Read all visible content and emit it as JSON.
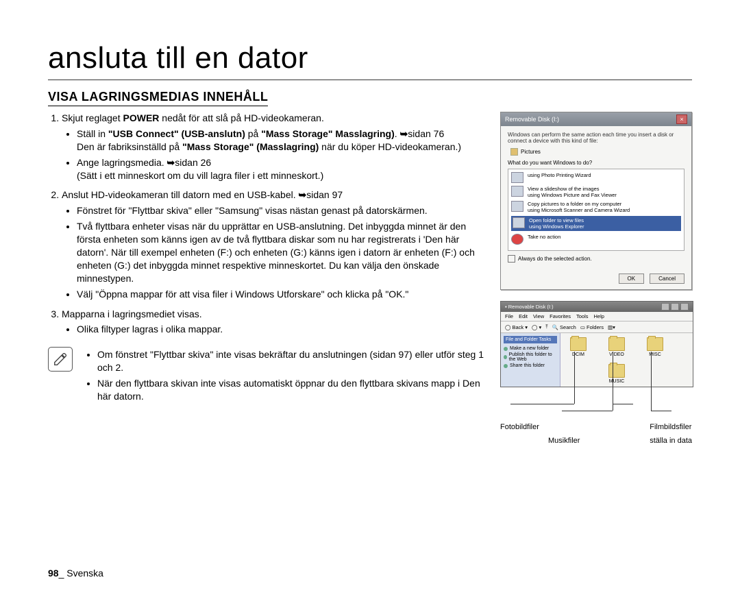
{
  "page_title": "ansluta till en dator",
  "section_title": "VISA LAGRINGSMEDIAS INNEHÅLL",
  "steps": {
    "s1": {
      "label": "1.",
      "text_a": "Skjut reglaget ",
      "text_b": "POWER",
      "text_c": " nedåt för att slå på HD-videokameran.",
      "b1": {
        "a": "Ställ in ",
        "b": "\"USB Connect\" (USB-anslutn)",
        "c": " på ",
        "d": "\"Mass Storage\" Masslagring)",
        "e": ". ",
        "ref": "sidan 76",
        "para2a": "Den är fabriksinställd på ",
        "para2b": "\"Mass Storage\" (Masslagring)",
        "para2c": " när du köper HD-videokameran.)"
      },
      "b2": {
        "a": "Ange lagringsmedia. ",
        "ref": "sidan 26",
        "para2": "(Sätt i ett minneskort om du vill lagra filer i ett minneskort.)"
      }
    },
    "s2": {
      "label": "2.",
      "a": "Anslut HD-videokameran till datorn med en USB-kabel. ",
      "ref": "sidan 97",
      "b1": "Fönstret för \"Flyttbar skiva\" eller \"Samsung\" visas nästan genast på datorskärmen.",
      "b2": "Två flyttbara enheter visas när du upprättar en USB-anslutning. Det inbyggda minnet är den första enheten som känns igen av de två flyttbara diskar som nu har registrerats i 'Den här datorn'. När till exempel enheten (F:) och enheten (G:) känns igen i datorn är enheten (F:) och enheten (G:) det inbyggda minnet respektive minneskortet. Du kan välja den önskade minnestypen.",
      "b3": "Välj \"Öppna mappar för att visa filer i Windows Utforskare\" och klicka på \"OK.\""
    },
    "s3": {
      "label": "3.",
      "a": "Mapparna i lagringsmediet visas.",
      "b1": "Olika filtyper lagras i olika mappar."
    }
  },
  "notes": {
    "n1": "Om fönstret \"Flyttbar skiva\" inte visas bekräftar du anslutningen (sidan 97) eller utför steg 1 och 2.",
    "n2": "När den flyttbara skivan inte visas automatiskt öppnar du den flyttbara skivans mapp i Den här datorn."
  },
  "arrow_glyph": "➥",
  "dialog": {
    "title": "Removable Disk (I:)",
    "intro": "Windows can perform the same action each time you insert a disk or connect a device with this kind of file:",
    "pictures": "Pictures",
    "question": "What do you want Windows to do?",
    "opts": {
      "o1a": "using Photo Printing Wizard",
      "o2a": "View a slideshow of the images",
      "o2b": "using Windows Picture and Fax Viewer",
      "o3a": "Copy pictures to a folder on my computer",
      "o3b": "using Microsoft Scanner and Camera Wizard",
      "o4a": "Open folder to view files",
      "o4b": "using Windows Explorer",
      "o5a": "Take no action"
    },
    "always": "Always do the selected action.",
    "ok": "OK",
    "cancel": "Cancel"
  },
  "explorer": {
    "title": "Removable Disk (I:)",
    "menu": {
      "file": "File",
      "edit": "Edit",
      "view": "View",
      "fav": "Favorites",
      "tools": "Tools",
      "help": "Help"
    },
    "toolbar": {
      "back": "Back",
      "search": "Search",
      "folders": "Folders"
    },
    "sidebar": {
      "header": "File and Folder Tasks",
      "i1": "Make a new folder",
      "i2": "Publish this folder to the Web",
      "i3": "Share this folder"
    },
    "folders": {
      "f1": "DCIM",
      "f2": "VIDEO",
      "f3": "MISC",
      "f4": "MUSIC"
    }
  },
  "labels": {
    "l1": "Fotobildfiler",
    "l2": "Musikfiler",
    "l3": "Filmbildsfiler",
    "l4": "ställa in data"
  },
  "footer": {
    "page": "98",
    "sep": "_ ",
    "lang": "Svenska"
  }
}
